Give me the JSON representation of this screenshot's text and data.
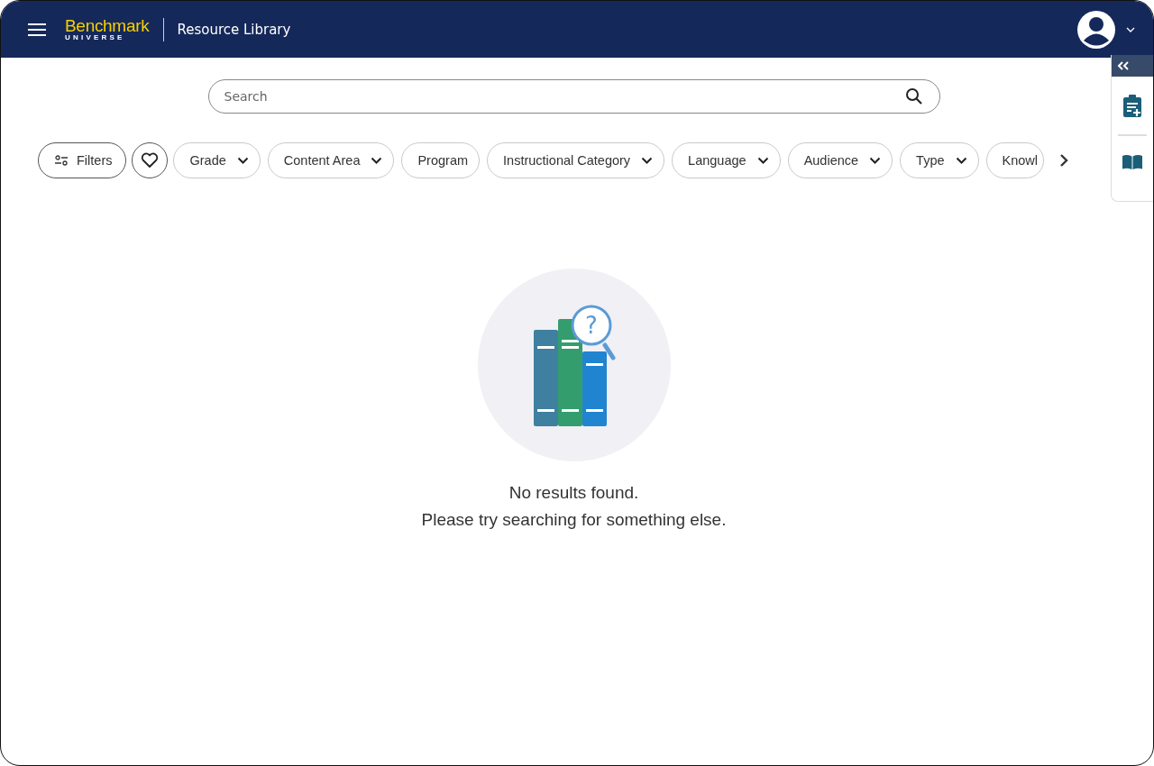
{
  "header": {
    "logo_top": "Benchmark",
    "logo_bottom": "UNIVERSE",
    "title": "Resource Library"
  },
  "search": {
    "placeholder": "Search"
  },
  "filters_button": "Filters",
  "chips": [
    {
      "label": "Grade",
      "dropdown": true
    },
    {
      "label": "Content Area",
      "dropdown": true
    },
    {
      "label": "Program",
      "dropdown": false
    },
    {
      "label": "Instructional Category",
      "dropdown": true
    },
    {
      "label": "Language",
      "dropdown": true
    },
    {
      "label": "Audience",
      "dropdown": true
    },
    {
      "label": "Type",
      "dropdown": true
    },
    {
      "label": "Knowl",
      "dropdown": false
    }
  ],
  "empty_state": {
    "mark": "?",
    "lines": [
      "No results found.",
      "Please try searching for something else."
    ]
  }
}
